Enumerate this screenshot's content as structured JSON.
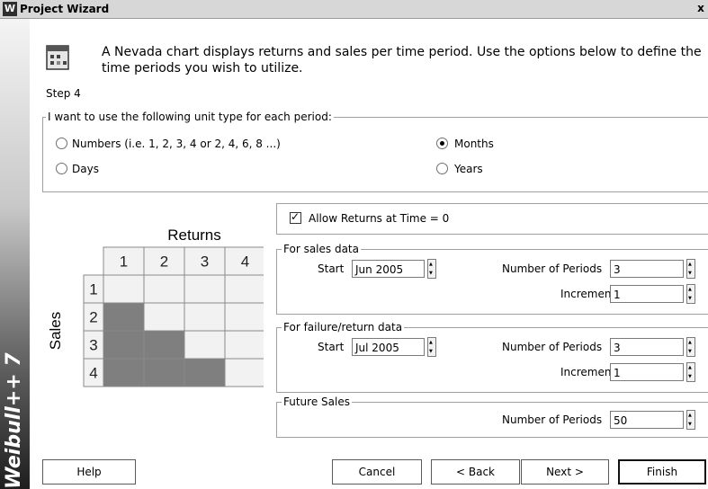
{
  "window": {
    "title": "Project Wizard",
    "app_icon": "W",
    "close_glyph": "x",
    "brand": "Weibull++ 7"
  },
  "header": {
    "intro": "A Nevada chart displays returns and sales per time period. Use the options below to define the time periods you wish to utilize.",
    "step": "Step 4"
  },
  "unit_type": {
    "legend": "I want to use the following unit type for each period:",
    "options": [
      {
        "label": "Numbers (i.e. 1, 2, 3, 4 or 2, 4, 6, 8 ...)",
        "selected": false
      },
      {
        "label": "Months",
        "selected": true
      },
      {
        "label": "Days",
        "selected": false
      },
      {
        "label": "Years",
        "selected": false
      }
    ]
  },
  "nevada": {
    "returns_label": "Returns",
    "sales_label": "Sales",
    "columns": [
      "1",
      "2",
      "3",
      "4"
    ],
    "rows": [
      "1",
      "2",
      "3",
      "4"
    ],
    "shaded_color": "#7f7f7f",
    "cell_color": "#f2f2f2"
  },
  "allow_returns": {
    "label": "Allow Returns at Time = 0",
    "checked": true
  },
  "sales_data": {
    "legend": "For sales data",
    "start_label": "Start",
    "start_value": "Jun 2005",
    "periods_label": "Number of Periods",
    "periods_value": "3",
    "increment_label": "Increment",
    "increment_value": "1"
  },
  "failure_data": {
    "legend": "For failure/return data",
    "start_label": "Start",
    "start_value": "Jul 2005",
    "periods_label": "Number of Periods",
    "periods_value": "3",
    "increment_label": "Increment",
    "increment_value": "1"
  },
  "future_sales": {
    "legend": "Future Sales",
    "periods_label": "Number of Periods",
    "periods_value": "50"
  },
  "buttons": {
    "help": "Help",
    "cancel": "Cancel",
    "back": "< Back",
    "next": "Next >",
    "finish": "Finish"
  }
}
